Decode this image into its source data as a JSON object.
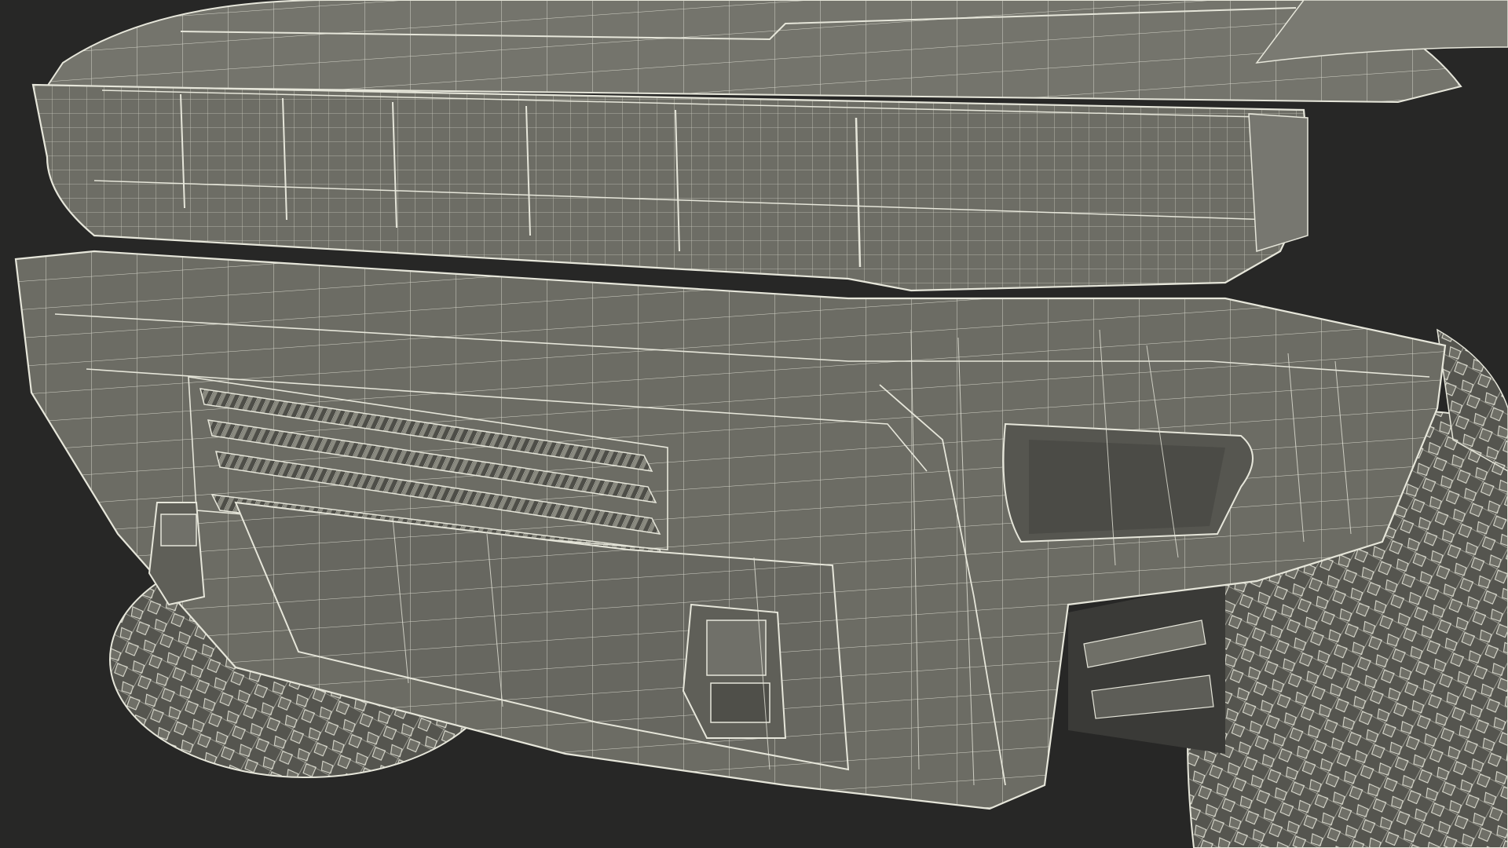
{
  "scene": {
    "subject": "wireframe-render-truck-front",
    "colors": {
      "background": "#272726",
      "surface": "#6f6f67",
      "surface_light": "#85857c",
      "surface_dark": "#55554f",
      "wire": "#e6e6da",
      "shadow": "#1e1e1d"
    }
  }
}
